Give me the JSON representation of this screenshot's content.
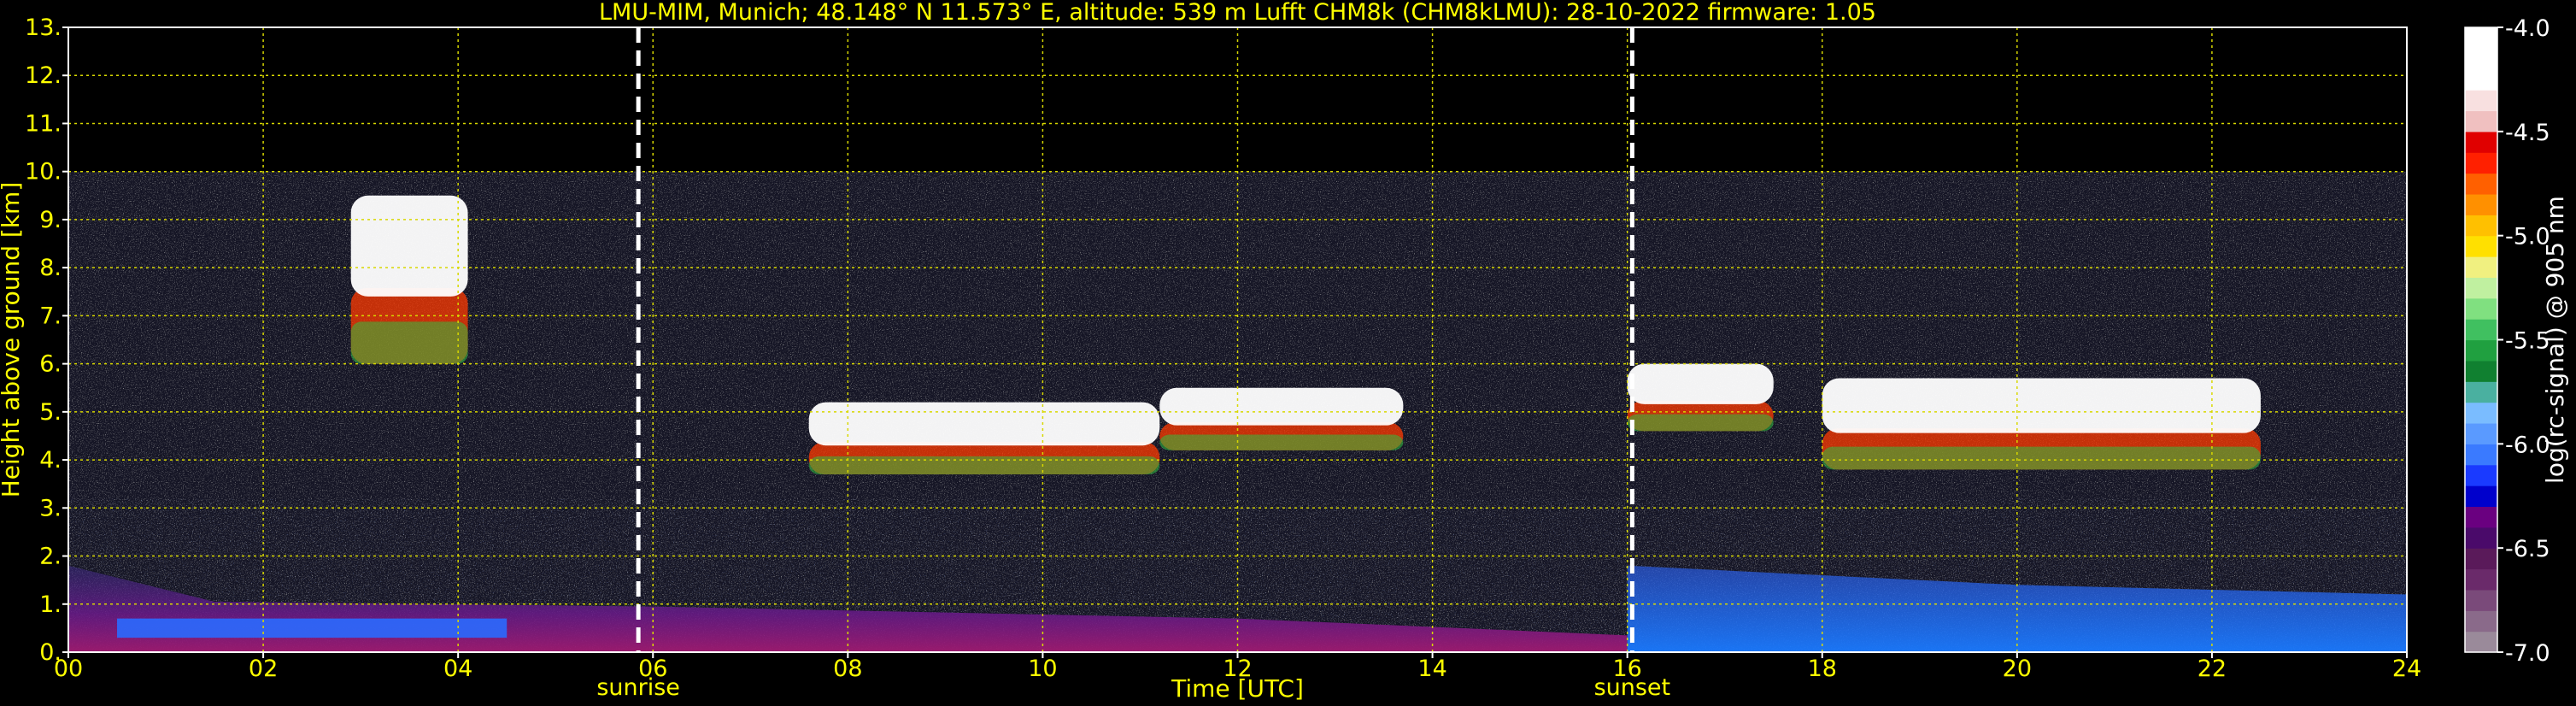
{
  "chart_data": {
    "type": "heatmap",
    "title": "LMU-MIM, Munich; 48.148° N 11.573° E, altitude: 539 m    Lufft CHM8k (CHM8kLMU): 28-10-2022    firmware: 1.05",
    "xlabel": "Time [UTC]",
    "ylabel": "Height above ground [km]",
    "xlim": [
      0,
      24
    ],
    "ylim": [
      0,
      13
    ],
    "x_ticks": [
      "00",
      "02",
      "04",
      "06",
      "08",
      "10",
      "12",
      "14",
      "16",
      "18",
      "20",
      "22",
      "24"
    ],
    "x_tick_values": [
      0,
      2,
      4,
      6,
      8,
      10,
      12,
      14,
      16,
      18,
      20,
      22,
      24
    ],
    "y_ticks": [
      "0.",
      "1.",
      "2.",
      "3.",
      "4.",
      "5.",
      "6.",
      "7.",
      "8.",
      "9.",
      "10.",
      "11.",
      "12.",
      "13."
    ],
    "y_tick_values": [
      0,
      1,
      2,
      3,
      4,
      5,
      6,
      7,
      8,
      9,
      10,
      11,
      12,
      13
    ],
    "grid": true,
    "data_top_km": 10,
    "markers": [
      {
        "label": "sunrise",
        "x": 5.85
      },
      {
        "label": "sunset",
        "x": 16.05
      }
    ],
    "colorbar": {
      "label": "log(rc-signal) @ 905 nm",
      "range": [
        -7.0,
        -4.0
      ],
      "ticks": [
        "-4.0",
        "-4.5",
        "-5.0",
        "-5.5",
        "-6.0",
        "-6.5",
        "-7.0"
      ],
      "tick_values": [
        -4.0,
        -4.5,
        -5.0,
        -5.5,
        -6.0,
        -6.5,
        -7.0
      ],
      "colors": [
        "#9a8a9a",
        "#8a6a8a",
        "#7a4a7a",
        "#6a2a6a",
        "#5a1a5a",
        "#4a0a6a",
        "#6a0080",
        "#0000cc",
        "#1a3aff",
        "#3a7aff",
        "#5a9aff",
        "#7abcff",
        "#4ab0a0",
        "#108030",
        "#20a040",
        "#40c060",
        "#80e080",
        "#c0f0a0",
        "#f0f080",
        "#ffe000",
        "#ffc000",
        "#ff9000",
        "#ff6000",
        "#ff2000",
        "#e00000",
        "#f0c0c0",
        "#f8e0e0",
        "#ffffff",
        "#ffffff",
        "#ffffff"
      ]
    },
    "cloud_layers": [
      {
        "x_start": 7.6,
        "x_end": 11.2,
        "base_km": 3.7,
        "top_km": 5.2
      },
      {
        "x_start": 11.2,
        "x_end": 13.7,
        "base_km": 4.2,
        "top_km": 5.5
      },
      {
        "x_start": 16.0,
        "x_end": 17.5,
        "base_km": 4.6,
        "top_km": 6.0
      },
      {
        "x_start": 18.0,
        "x_end": 22.5,
        "base_km": 3.8,
        "top_km": 5.7
      },
      {
        "x_start": 2.9,
        "x_end": 4.1,
        "base_km": 6.0,
        "top_km": 9.5
      }
    ],
    "aerosol_layer": {
      "top_km_morning": 1.8,
      "top_km_evening": 1.2
    }
  }
}
